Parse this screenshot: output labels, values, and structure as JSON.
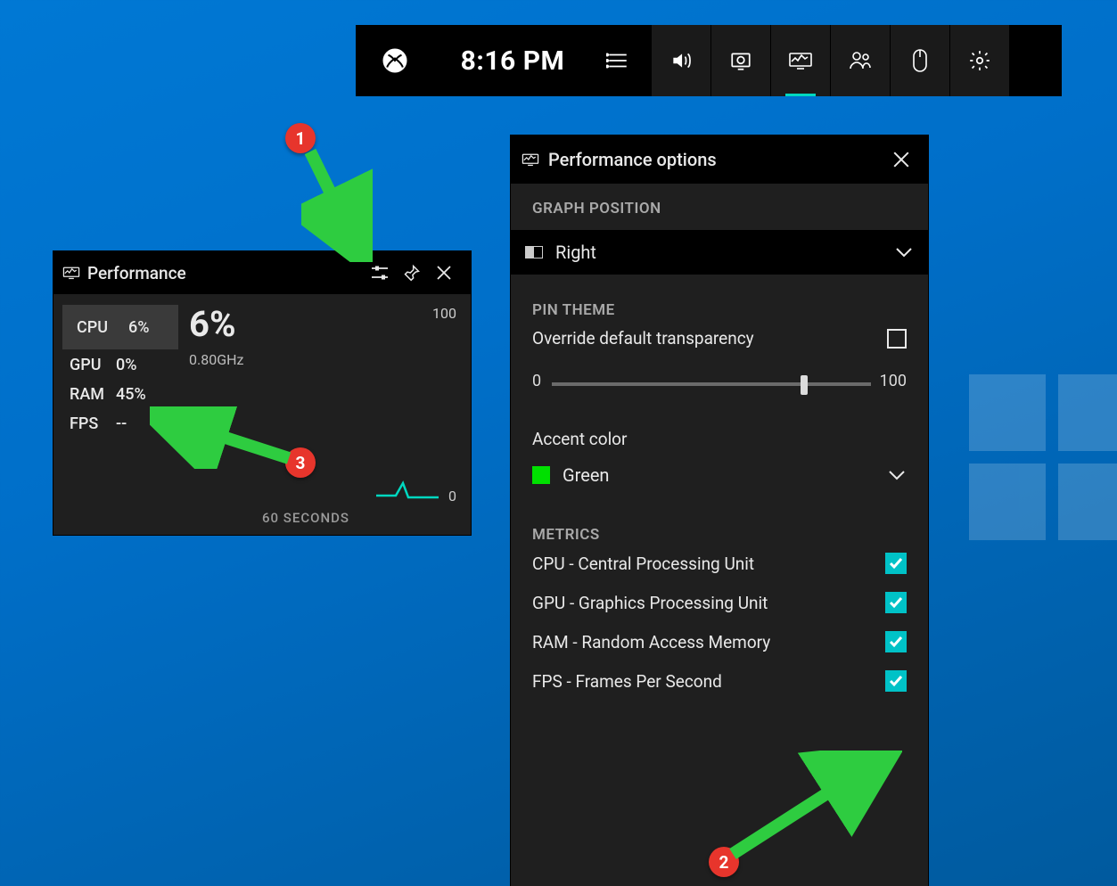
{
  "topbar": {
    "time": "8:16 PM",
    "icons": [
      "xbox",
      "list",
      "audio",
      "capture",
      "performance",
      "social",
      "mouse",
      "settings"
    ],
    "active": "performance"
  },
  "performance_widget": {
    "title": "Performance",
    "metrics": [
      {
        "label": "CPU",
        "value": "6%",
        "selected": true
      },
      {
        "label": "GPU",
        "value": "0%",
        "selected": false
      },
      {
        "label": "RAM",
        "value": "45%",
        "selected": false
      },
      {
        "label": "FPS",
        "value": "--",
        "selected": false
      }
    ],
    "big_value": "6%",
    "sub_value": "0.80GHz",
    "graph": {
      "y_max": "100",
      "y_min": "0",
      "x_label": "60 SECONDS"
    }
  },
  "options_panel": {
    "title": "Performance options",
    "graph_position": {
      "heading": "GRAPH POSITION",
      "value": "Right"
    },
    "pin_theme": {
      "heading": "PIN THEME",
      "override_label": "Override default transparency",
      "override_checked": false,
      "slider": {
        "min": "0",
        "max": "100",
        "value": 78
      }
    },
    "accent": {
      "heading": "Accent color",
      "value": "Green",
      "swatch": "#00e000"
    },
    "metrics": {
      "heading": "METRICS",
      "items": [
        {
          "label": "CPU - Central Processing Unit",
          "checked": true
        },
        {
          "label": "GPU - Graphics Processing Unit",
          "checked": true
        },
        {
          "label": "RAM - Random Access Memory",
          "checked": true
        },
        {
          "label": "FPS - Frames Per Second",
          "checked": true
        }
      ]
    }
  },
  "annotations": {
    "one": "1",
    "two": "2",
    "three": "3"
  }
}
